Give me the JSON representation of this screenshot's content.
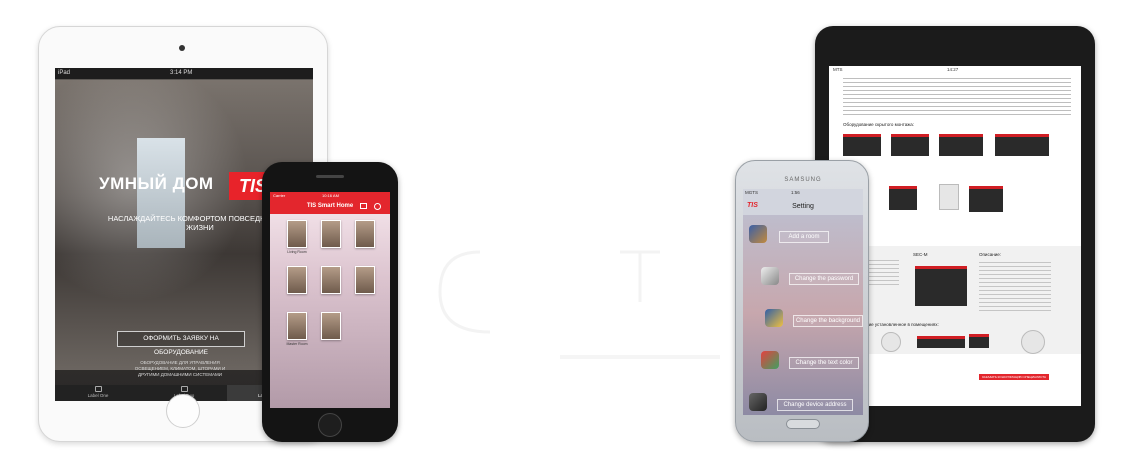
{
  "ipad": {
    "status_left": "iPad",
    "status_time": "3:14 PM",
    "brand_text": "УМНЫЙ ДОМ",
    "logo_text": "TIS",
    "tagline": "НАСЛАЖДАЙТЕСЬ КОМФОРТОМ ПОВСЕДНЕВНОЙ ЖИЗНИ",
    "order_button": "ОФОРМИТЬ ЗАЯВКУ НА ОБОРУДОВАНИЕ",
    "small_text": "ОБОРУДОВАНИЕ ДЛЯ УПРАВЛЕНИЯ ОСВЕЩЕНИЕМ, КЛИМАТОМ, ШТОРАМИ И ДРУГИМИ ДОМАШНИМИ СИСТЕМАМИ",
    "tabs": [
      "Label One",
      "Label Two",
      "Label Three"
    ]
  },
  "iphone": {
    "status_left": "Carrier",
    "status_time": "10:16 AM",
    "title": "TIS Smart Home",
    "rooms": [
      "Living Room",
      "",
      "",
      "",
      "",
      "",
      "Master Room",
      ""
    ]
  },
  "samsung": {
    "brand": "SAMSUNG",
    "status_left": "MGTS",
    "status_time": "1:56",
    "logo": "TIS",
    "title": "Setting",
    "buttons": [
      "Add a room",
      "Change the password",
      "Change the background",
      "Change the text color",
      "Change device address"
    ]
  },
  "tablet": {
    "status_left": "MTS",
    "status_time": "14:27",
    "section1": "Оборудование скрытого монтажа:",
    "section2": "Оборудование установленное в помещениях:",
    "device_title": "SEC-M",
    "device_label": "Описание:",
    "red_button": "ЗАКАЗАТЬ КОНСУЛЬТАЦИЮ СПЕЦИАЛИСТА"
  }
}
